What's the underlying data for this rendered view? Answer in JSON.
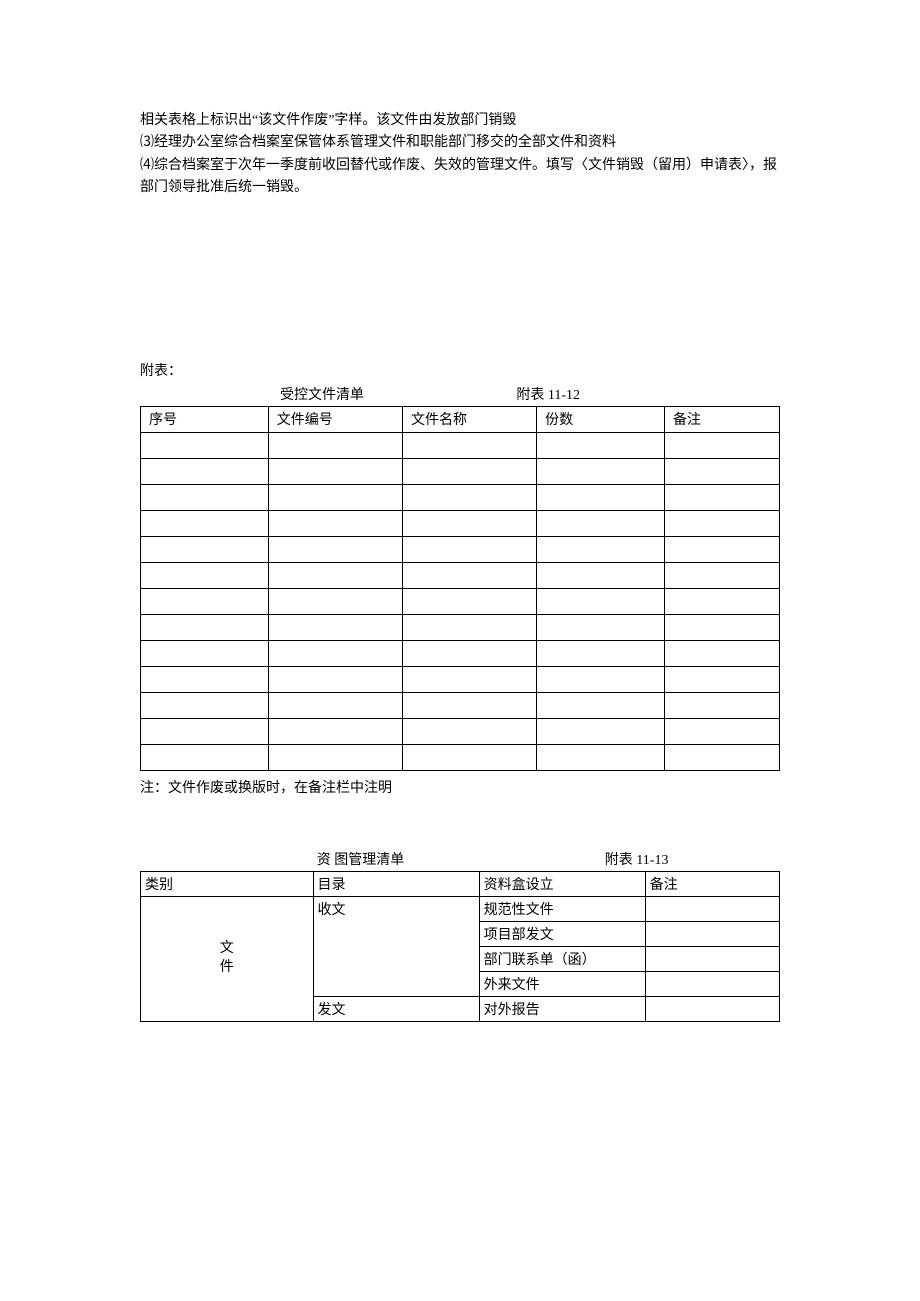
{
  "paragraphs": {
    "p1": "相关表格上标识出“该文件作废”字样。该文件由发放部门销毁",
    "p2": "⑶经理办公室综合档案室保管体系管理文件和职能部门移交的全部文件和资料",
    "p3": "⑷综合档案室于次年一季度前收回替代或作废、失效的管理文件。填写〈文件销毁（留用）申请表〉，报部门领导批准后统一销毁。"
  },
  "attach_label": "附表：",
  "table1": {
    "title": "受控文件清单",
    "appendix": "附表 11-12",
    "headers": [
      "序号",
      "文件编号",
      "文件名称",
      "份数",
      "备注"
    ],
    "row_count": 13,
    "note": "注：文件作废或换版时，在备注栏中注明"
  },
  "table2": {
    "title": "资 图管理清单",
    "appendix": "附表 11-13",
    "headers": [
      "类别",
      "目录",
      "资料盒设立",
      "备注"
    ],
    "category_vertical": "文\n件",
    "dir1": "收文",
    "dir2": "发文",
    "boxes": [
      "规范性文件",
      "项目部发文",
      "部门联系单（函）",
      "外来文件",
      "对外报告"
    ]
  }
}
